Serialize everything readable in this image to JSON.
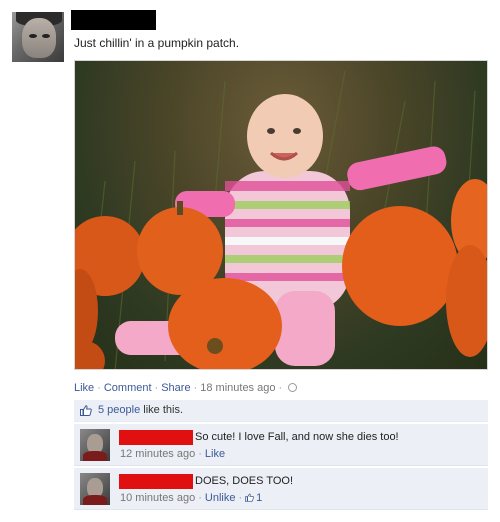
{
  "post": {
    "status": "Just chillin' in a pumpkin patch.",
    "actions": {
      "like": "Like",
      "comment": "Comment",
      "share": "Share",
      "time": "18 minutes ago",
      "dot": "·"
    },
    "likes": {
      "count_text": "5 people",
      "suffix": " like this."
    }
  },
  "comments": [
    {
      "text": "So cute! I love Fall, and now she dies too!",
      "time": "12 minutes ago",
      "action": "Like"
    },
    {
      "text": "DOES, DOES TOO!",
      "time": "10 minutes ago",
      "action": "Unlike",
      "like_count": "1"
    }
  ],
  "colors": {
    "link": "#3b5998",
    "redaction_name": "#000000",
    "redaction_comment": "#e01010",
    "panel": "#eceff5"
  },
  "icons": {
    "like": "thumbs-up-icon",
    "privacy": "globe-icon"
  }
}
